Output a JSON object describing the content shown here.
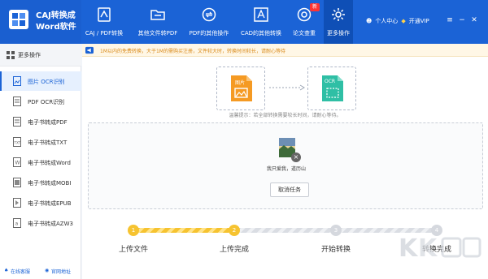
{
  "app": {
    "name_line1": "CAJ转换成",
    "name_line2": "Word软件"
  },
  "nav": [
    {
      "label": "CAJ / PDF转换",
      "icon": "pdf-convert-icon"
    },
    {
      "label": "其他文件转PDF",
      "icon": "folder-icon"
    },
    {
      "label": "PDF的其他操作",
      "icon": "refresh-icon"
    },
    {
      "label": "CAD的其他转换",
      "icon": "cad-icon"
    },
    {
      "label": "论文查重",
      "icon": "at-sign-icon",
      "badge": "新"
    },
    {
      "label": "更多操作",
      "icon": "gear-icon"
    }
  ],
  "user": {
    "profile": "个人中心",
    "vip": "开通VIP"
  },
  "sidebar": {
    "header": "更多操作",
    "items": [
      {
        "label": "图片 OCR识别"
      },
      {
        "label": "PDF OCR识别"
      },
      {
        "label": "电子书转成PDF"
      },
      {
        "label": "电子书转成TXT"
      },
      {
        "label": "电子书转成Word"
      },
      {
        "label": "电子书转成MOBI"
      },
      {
        "label": "电子书转成EPUB"
      },
      {
        "label": "电子书转成AZW3"
      }
    ],
    "footer_service": "在线客服",
    "footer_site": "官网地址"
  },
  "notice": {
    "text": "1M以内的免费转换，大于1M的需购买注册，文件较大时，转换时间较长，请耐心等待"
  },
  "flow": {
    "source_label": "图片",
    "target_label": "OCR"
  },
  "tip": "温馨提示：若全部转换需要较长时间，请耐心等待。",
  "file": {
    "name": "我只爱我，道历山"
  },
  "cancel_label": "取消任务",
  "steps": [
    {
      "num": "1",
      "label": "上传文件"
    },
    {
      "num": "2",
      "label": "上传完成"
    },
    {
      "num": "3",
      "label": "开始转换"
    },
    {
      "num": "4",
      "label": "转换完成"
    }
  ],
  "progress": {
    "completed_steps": 2,
    "total_steps": 4
  },
  "colors": {
    "topbar": "#1b63d6",
    "accent": "#1b63d6",
    "step_done": "#f6c330",
    "step_pending": "#d5d8de",
    "notice_text": "#d98a1a",
    "source_badge": "#f59a23",
    "target_badge": "#2fbfa5"
  }
}
